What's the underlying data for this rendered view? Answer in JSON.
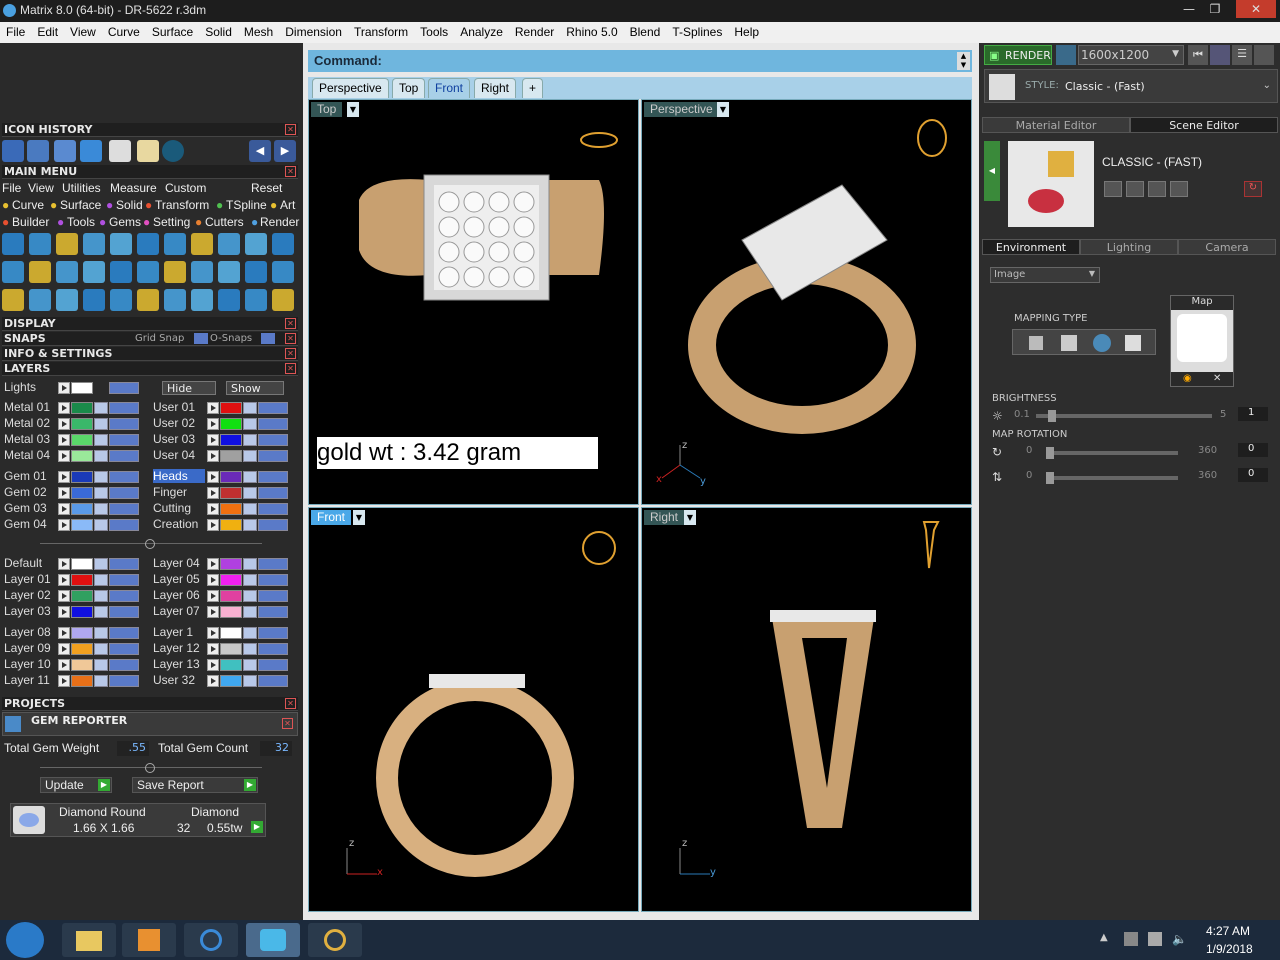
{
  "window": {
    "title": "Matrix 8.0 (64-bit) - DR-5622 r.3dm",
    "minimize": "—",
    "maximize": "❐",
    "close": "✕"
  },
  "menubar": [
    "File",
    "Edit",
    "View",
    "Curve",
    "Surface",
    "Solid",
    "Mesh",
    "Dimension",
    "Transform",
    "Tools",
    "Analyze",
    "Render",
    "Rhino 5.0",
    "Blend",
    "T-Splines",
    "Help"
  ],
  "left": {
    "icon_history": "ICON HISTORY",
    "main_menu": "MAIN MENU",
    "main_menu_row1": [
      "File",
      "View",
      "Utilities",
      "Measure",
      "Custom",
      "Reset"
    ],
    "main_menu_row2": [
      "Curve",
      "Surface",
      "Solid",
      "Transform",
      "TSpline",
      "Art"
    ],
    "main_menu_row3": [
      "Builder",
      "Tools",
      "Gems",
      "Setting",
      "Cutters",
      "Render"
    ],
    "display": "DISPLAY",
    "snaps": "SNAPS",
    "grid_snap": "Grid Snap",
    "o_snaps": "O-Snaps",
    "info_settings": "INFO & SETTINGS",
    "layers": "LAYERS",
    "lights": "Lights",
    "hide": "Hide",
    "show": "Show",
    "layer_rows_left": [
      {
        "name": "Metal 01",
        "color": "#1a8a4a"
      },
      {
        "name": "Metal 02",
        "color": "#3ab86a"
      },
      {
        "name": "Metal 03",
        "color": "#5ad86a"
      },
      {
        "name": "Metal 04",
        "color": "#9ae89a"
      },
      {
        "name": "Gem 01",
        "color": "#1a3ab8"
      },
      {
        "name": "Gem 02",
        "color": "#3a6ad8"
      },
      {
        "name": "Gem 03",
        "color": "#5a9ae8"
      },
      {
        "name": "Gem 04",
        "color": "#8abaf8"
      },
      {
        "name": "Default",
        "color": "#ffffff"
      },
      {
        "name": "Layer 01",
        "color": "#e01010"
      },
      {
        "name": "Layer 02",
        "color": "#30a060"
      },
      {
        "name": "Layer 03",
        "color": "#1010e0"
      },
      {
        "name": "Layer 08",
        "color": "#b0a8f0"
      },
      {
        "name": "Layer 09",
        "color": "#f0a020"
      },
      {
        "name": "Layer 10",
        "color": "#f0c898"
      },
      {
        "name": "Layer 11",
        "color": "#e87018"
      }
    ],
    "layer_rows_right": [
      {
        "name": "User 01",
        "color": "#e01010"
      },
      {
        "name": "User 02",
        "color": "#10e010"
      },
      {
        "name": "User 03",
        "color": "#1010e0"
      },
      {
        "name": "User 04",
        "color": "#a0a0a0"
      },
      {
        "name": "Heads",
        "color": "#6a2ab8"
      },
      {
        "name": "Finger",
        "color": "#c03030"
      },
      {
        "name": "Cutting",
        "color": "#f07010"
      },
      {
        "name": "Creation",
        "color": "#f0b010"
      },
      {
        "name": "Layer 04",
        "color": "#b040e0"
      },
      {
        "name": "Layer 05",
        "color": "#f020f0"
      },
      {
        "name": "Layer 06",
        "color": "#e040a0"
      },
      {
        "name": "Layer 07",
        "color": "#f8b0d0"
      },
      {
        "name": "Layer 1",
        "color": "#ffffff"
      },
      {
        "name": "Layer 12",
        "color": "#c8c8c8"
      },
      {
        "name": "Layer 13",
        "color": "#40c0c0"
      },
      {
        "name": "User 32",
        "color": "#40a8f0"
      }
    ],
    "projects": "PROJECTS",
    "gem_reporter": "GEM REPORTER",
    "total_gem_weight_label": "Total Gem Weight",
    "total_gem_weight": ".55",
    "total_gem_count_label": "Total Gem Count",
    "total_gem_count": "32",
    "update": "Update",
    "save_report": "Save Report",
    "gem_shape": "Diamond Round",
    "gem_material": "Diamond",
    "gem_size": "1.66 X 1.66",
    "gem_count": "32",
    "gem_weight": "0.55tw"
  },
  "command": {
    "label": "Command:",
    "value": ""
  },
  "viewport_tabs": [
    "Perspective",
    "Top",
    "Front",
    "Right"
  ],
  "viewport_add": "+",
  "viewports": {
    "top": "Top",
    "perspective": "Perspective",
    "front": "Front",
    "right": "Right"
  },
  "annotation": "gold wt : 3.42 gram",
  "axes": {
    "x": "x",
    "y": "y",
    "z": "z"
  },
  "right": {
    "render_btn": "RENDER",
    "resolution": "1600x1200",
    "style_label": "STYLE:",
    "style_value": "Classic - (Fast)",
    "tab_material": "Material Editor",
    "tab_scene": "Scene Editor",
    "scene_name": "CLASSIC - (FAST)",
    "tab_environment": "Environment",
    "tab_lighting": "Lighting",
    "tab_camera": "Camera",
    "env_select": "Image",
    "mapping_type": "MAPPING TYPE",
    "map_label": "Map",
    "brightness": "BRIGHTNESS",
    "brightness_min": "0.1",
    "brightness_max": "5",
    "brightness_value": "1",
    "brightness_level": 0.07,
    "map_rotation": "MAP ROTATION",
    "rot1_min": "0",
    "rot1_max": "360",
    "rot1_value": "0",
    "rot2_min": "0",
    "rot2_max": "360",
    "rot2_value": "0"
  },
  "taskbar": {
    "time": "4:27 AM",
    "date": "1/9/2018"
  }
}
